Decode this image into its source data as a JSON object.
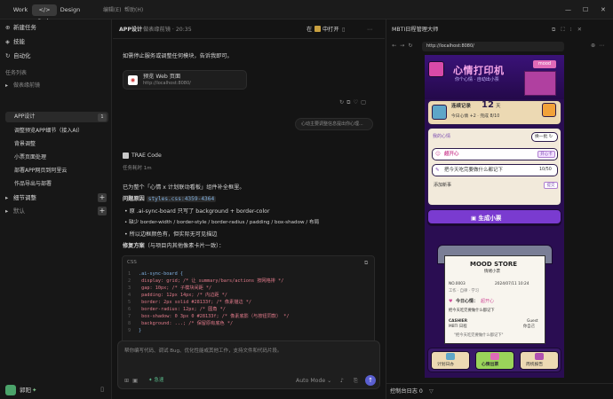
{
  "titlebar": {
    "work": "Work",
    "code": "</> Code",
    "design": "Design",
    "menu_edit": "编辑(E)",
    "menu_help": "帮助(H)",
    "min": "—",
    "max": "☐",
    "close": "✕"
  },
  "sidebar": {
    "new_task": "新建任务",
    "skills": "技能",
    "automation": "自动化",
    "task_list": "任务列表",
    "project": "做表缘前镜",
    "items": [
      "APP设计",
      "调整预览APP细节（接入AI）",
      "背景调整",
      "小票页面处理",
      "部署APP网页到阿里云",
      "作品导出与部署"
    ],
    "item0_badge": "1",
    "section2": "细节调整",
    "section3": "默认",
    "user": "郭阳",
    "user_badge": "✦"
  },
  "chat": {
    "title": "APP设计",
    "subtitle": "做表缘前镜 · 20:35",
    "open_in": "在",
    "open_btn": "中打开",
    "intro": "如需停止服务或调整任何模块，告诉我即可。",
    "preview_card_title": "预览 Web 页面",
    "preview_card_url": "http://localhost:8080/",
    "user_bubble": "心动主要调整信息提出你心理...",
    "assistant": "TRAE Code",
    "elapsed": "任务耗时 1m",
    "fixed_line": "已为整个「心情 x 计划联动看板」组件补全框里。",
    "problem_label": "问题原因",
    "problem_file": "styles.css:4359-4364",
    "bullet1": "原 .ai-sync-board 只写了 background + border-color",
    "bullet2": "缺少 border-width / border-style / border-radius / padding / box-shadow / 布局",
    "bullet3": "所以边框颜色有，但实际无可见描边",
    "fix_label": "修复方案",
    "fix_note": "（与项目内其他像素卡片一致）：",
    "code_lang": "CSS",
    "code_lines": [
      ".ai-sync-board {",
      "  display: grid;        /* 让 summary/bars/actions 按网格排 */",
      "  gap: 10px;            /* 子模块间距 */",
      "  padding: 12px 14px;   /* 内边距 */",
      "  border: 2px solid #28133f;   /* 像素描边 */",
      "  border-radius: 12px;         /* 圆角 */",
      "  box-shadow: 0 3px 0 #28133f; /* 像素底影（与按钮同款） */",
      "  background: ...;             /* 保留原有底色 */",
      "}"
    ],
    "input_placeholder": "帮你编写代码、调试 Bug、优化性能或其他工作，支持文件和代码片段。",
    "mode": "Auto Mode"
  },
  "preview": {
    "title": "MBTI日程管理大师",
    "url": "http://localhost:8080/",
    "app_title": "心情打印机",
    "app_sub": "你个心情 · 自动出小票",
    "mood_tag": "mood",
    "checkin_label": "连续记录",
    "checkin_days": "12",
    "checkin_unit": "天",
    "checkin_today": "今日心情 +2 · 完成 8/10",
    "section_label": "我的心情",
    "refresh_btn": "换一批 ↻",
    "mood_value": "超开心",
    "mood_btn": "开心卡",
    "task_text": "把今天吃完要做什么都记下",
    "task_count": "10/50",
    "add_task": "添加新事",
    "add_task_btn": "提交",
    "generate_btn": "生成小票",
    "receipt_store": "MOOD STORE",
    "receipt_sub": "情绪小票",
    "receipt_no": "NO.0003",
    "receipt_date": "2024/07/11 10:24",
    "receipt_tags": "工作 · 自律 · 学习",
    "receipt_mood_label": "今日心情：",
    "receipt_mood": "超开心",
    "receipt_task": "把今天吃完要做什么都记下",
    "cashier_label": "CASHIER",
    "cashier": "MBTI 日程",
    "guest_label": "Guest",
    "guest": "你自己",
    "receipt_note": "\"把今天吃完要做什么都记下\"",
    "nav": [
      "计划日办",
      "心情出票",
      "周统报告"
    ],
    "console": "控制台日志 0"
  }
}
